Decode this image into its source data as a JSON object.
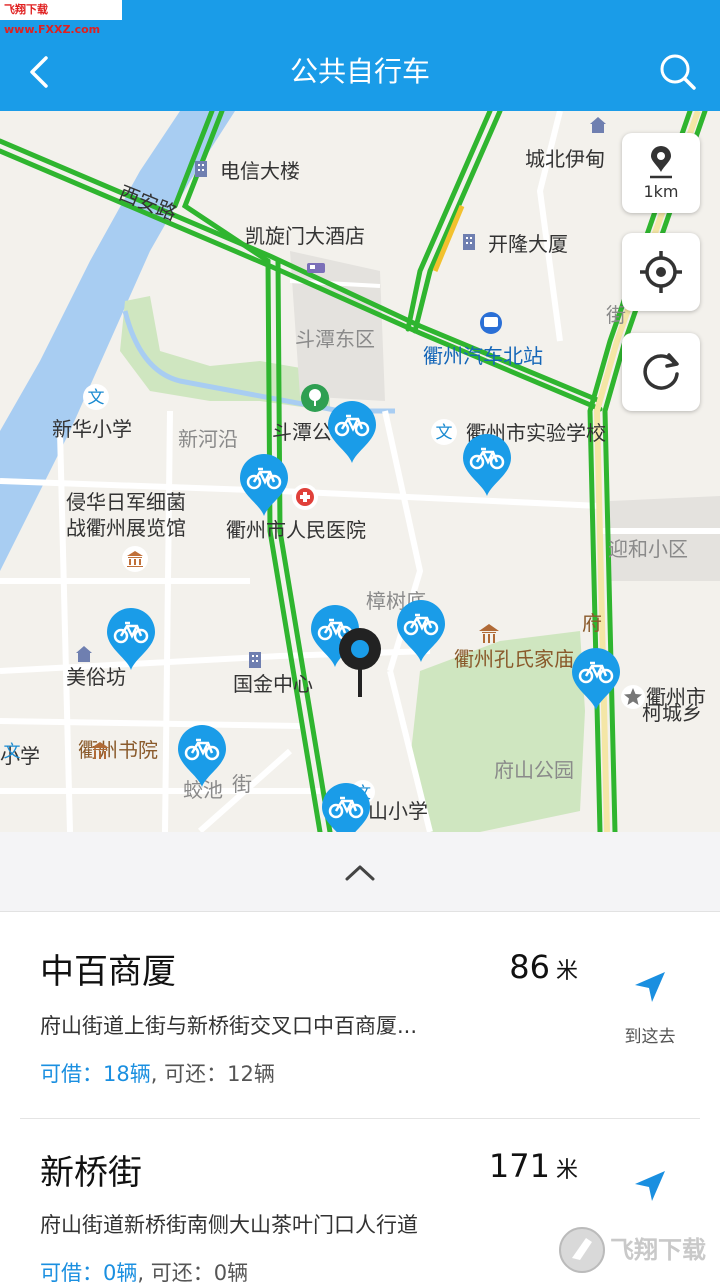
{
  "watermark": "飞翔下载 www.FXXZ.com",
  "header": {
    "title": "公共自行车",
    "back_icon": "chevron-left-icon",
    "search_icon": "search-icon",
    "background": "#1a9ce8"
  },
  "map": {
    "scale_label": "1km",
    "labels": {
      "xian_road": "西安路",
      "telecom": "电信大楼",
      "cheng_bei": "城北伊甸",
      "kaixuanmen": "凯旋门大酒店",
      "kailong": "开隆大厦",
      "doutan_east": "斗潭东区",
      "bus_station": "衢州汽车北站",
      "xinhua_school": "新华小学",
      "xinhe": "新河沿",
      "doutan_park": "斗潭公",
      "exp_school": "衢州市实验学校",
      "museum_line1": "侵华日军细菌",
      "museum_line2": "战衢州展览馆",
      "hospital": "衢州市人民医院",
      "yinghe": "迎和小区",
      "zhangshu": "樟树底",
      "kong_family": "衢州孔氏家庙",
      "fu": "府",
      "jie": "街",
      "meisu": "美俗坊",
      "guojin": "国金中心",
      "quzhou_right_1": "衢州市",
      "quzhou_right_2": "柯城乡",
      "xue": "小学",
      "shuyuan": "衢州书院",
      "jiaochi": "蛟池",
      "jiaochi_jie": "街",
      "fushan_park": "府山公园",
      "shan_school": "山小学",
      "wen": "文",
      "quzhou_bottom": "衢州市"
    },
    "road_color": "#2fb52f",
    "river_color": "#a8cdf2",
    "park_color": "#cfe6c0",
    "pin_color": "#1a9ce8"
  },
  "stations": [
    {
      "name": "中百商厦",
      "distance": "86",
      "unit": "米",
      "address": "府山街道上街与新桥街交叉口中百商厦...",
      "borrow_label": "可借：18辆",
      "return_label": "可还：12辆",
      "nav_label": "到这去"
    },
    {
      "name": "新桥街",
      "distance": "171",
      "unit": "米",
      "address": "府山街道新桥街南侧大山茶叶门口人行道",
      "borrow_label": "可借：0辆",
      "return_label": "可还：0辆",
      "nav_label": ""
    }
  ],
  "logo_text": "飞翔下载"
}
